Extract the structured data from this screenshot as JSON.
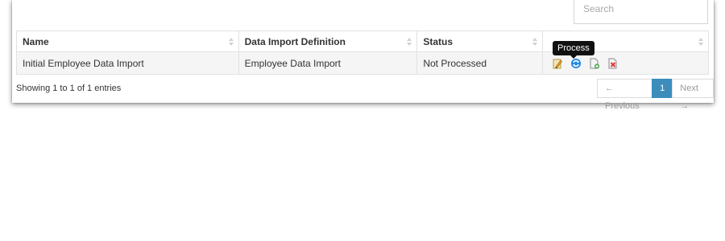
{
  "search": {
    "placeholder": "Search"
  },
  "table": {
    "headers": [
      "Name",
      "Data Import Definition",
      "Status",
      ""
    ],
    "rows": [
      {
        "name": "Initial Employee Data Import",
        "definition": "Employee Data Import",
        "status": "Not Processed"
      }
    ],
    "row_actions": [
      "edit-icon",
      "process-icon",
      "add-file-icon",
      "delete-icon"
    ]
  },
  "tooltip": {
    "text": "Process"
  },
  "footer": {
    "info": "Showing 1 to 1 of 1 entries",
    "previous": "← Previous",
    "page": "1",
    "next": "Next →"
  },
  "colors": {
    "accent": "#3c8dbc",
    "tooltip_bg": "#111111",
    "process_icon": "#1e88e5",
    "delete_icon": "#e53935"
  }
}
